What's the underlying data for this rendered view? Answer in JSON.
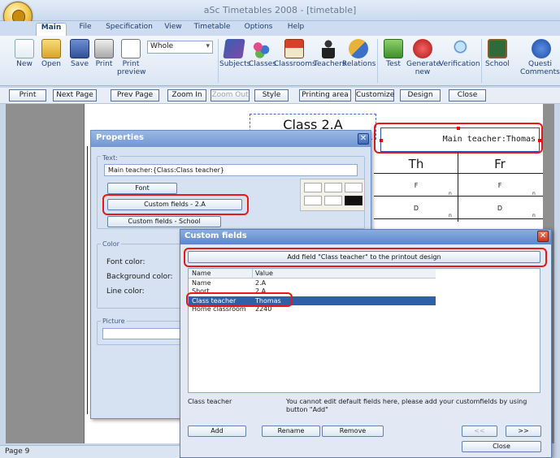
{
  "window": {
    "title": "aSc Timetables 2008  - [timetable]"
  },
  "tabs": [
    "Main",
    "File",
    "Specification",
    "View",
    "Timetable",
    "Options",
    "Help"
  ],
  "ribbon": {
    "buttons": [
      "New",
      "Open",
      "Save",
      "Print",
      "Print",
      "Subjects",
      "Classes",
      "Classrooms",
      "Teachers",
      "Relations",
      "Test",
      "Generate",
      "Verification",
      "School",
      "Questi"
    ],
    "sublabels": {
      "print_preview": "preview",
      "generate_new": "new",
      "questions": "Comments?"
    },
    "combo_value": "Whole"
  },
  "toolbar": [
    "Print",
    "Next Page",
    "Prev Page",
    "Zoom In",
    "Zoom Out",
    "Style",
    "Printing area",
    "Customize",
    "Design",
    "Close"
  ],
  "page": {
    "class_title": "Class 2.A",
    "main_teacher": "Main teacher:Thomas",
    "days": [
      "Th",
      "Fr"
    ],
    "cells": [
      [
        "F",
        "F"
      ],
      [
        "D",
        "D"
      ]
    ],
    "cell_mark": "n"
  },
  "properties": {
    "title": "Properties",
    "text_label": "Text:",
    "text_value": "Main teacher:{Class:Class teacher}",
    "font_btn": "Font",
    "custom_fields_btn": "Custom fields - 2.A",
    "custom_school_btn": "Custom fields - School",
    "color_label": "Color",
    "font_color": "Font color:",
    "bg_color": "Background color:",
    "line_color": "Line color:",
    "picture_label": "Picture"
  },
  "custom_fields": {
    "title": "Custom fields",
    "add_field_btn": "Add field \"Class teacher\" to the printout design",
    "col_name": "Name",
    "col_value": "Value",
    "rows": [
      {
        "name": "Name",
        "value": "2.A"
      },
      {
        "name": "Short",
        "value": "2.A"
      },
      {
        "name": "Class teacher",
        "value": "Thomas"
      },
      {
        "name": "Home classroom",
        "value": "2240"
      }
    ],
    "selected_name": "Class teacher",
    "note": "You cannot edit default fields here, please add your customfields by using button \"Add\"",
    "add": "Add",
    "rename": "Rename",
    "remove": "Remove",
    "prev": "<<",
    "next": ">>",
    "close": "Close"
  },
  "status": {
    "page": "Page 9"
  },
  "colors": {
    "highlight": "#e81818",
    "selection": "#2f5fa8"
  }
}
